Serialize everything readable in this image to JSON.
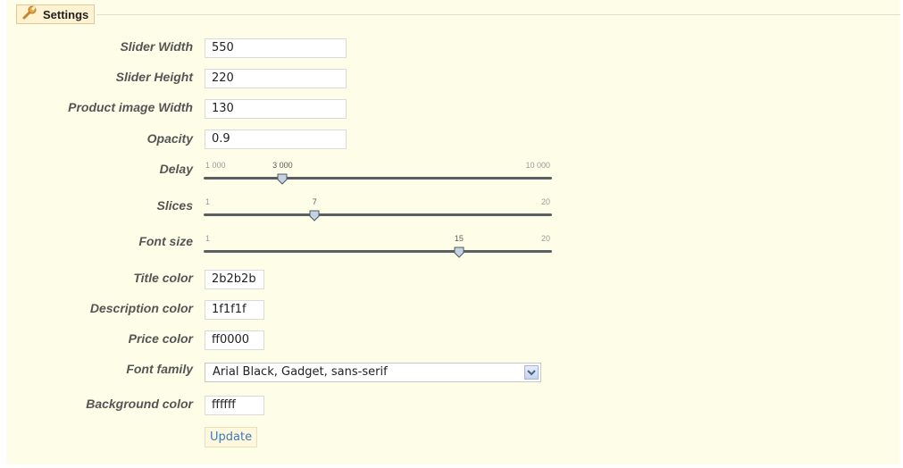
{
  "panel": {
    "legend_title": "Settings",
    "legend_icon": "wrench-icon"
  },
  "fields": {
    "slider_width": {
      "label": "Slider Width",
      "value": "550"
    },
    "slider_height": {
      "label": "Slider Height",
      "value": "220"
    },
    "product_image_width": {
      "label": "Product image Width",
      "value": "130"
    },
    "opacity": {
      "label": "Opacity",
      "value": "0.9"
    },
    "title_color": {
      "label": "Title color",
      "value": "2b2b2b"
    },
    "description_color": {
      "label": "Description color",
      "value": "1f1f1f"
    },
    "price_color": {
      "label": "Price color",
      "value": "ff0000"
    },
    "font_family": {
      "label": "Font family",
      "value": "Arial Black, Gadget, sans-serif"
    },
    "background_color": {
      "label": "Background color",
      "value": "ffffff"
    }
  },
  "sliders": {
    "delay": {
      "label": "Delay",
      "min": 1000,
      "max": 10000,
      "value": 3000,
      "min_label": "1 000",
      "max_label": "10 000",
      "value_label": "3 000"
    },
    "slices": {
      "label": "Slices",
      "min": 1,
      "max": 20,
      "value": 7,
      "min_label": "1",
      "max_label": "20",
      "value_label": "7"
    },
    "font_size": {
      "label": "Font size",
      "min": 1,
      "max": 20,
      "value": 15,
      "min_label": "1",
      "max_label": "20",
      "value_label": "15"
    }
  },
  "actions": {
    "update_label": "Update"
  },
  "colors": {
    "panel_background": "#fefee8",
    "legend_background": "#fff3d1",
    "link_blue": "#3c7ab8"
  }
}
